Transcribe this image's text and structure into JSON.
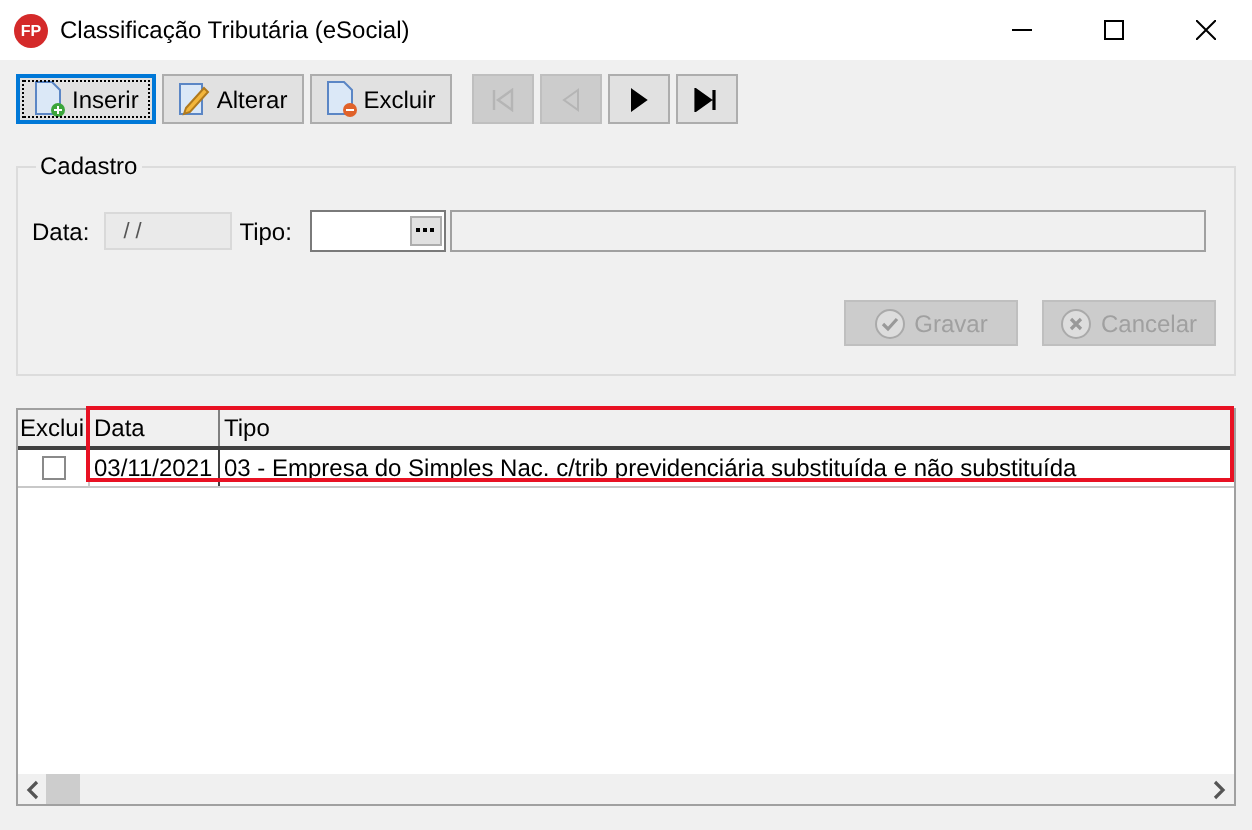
{
  "window": {
    "title": "Classificação Tributária (eSocial)",
    "app_badge": "FP"
  },
  "toolbar": {
    "buttons": [
      {
        "kind": "insert",
        "label": "Inserir",
        "focused": true
      },
      {
        "kind": "edit",
        "label": "Alterar",
        "focused": false
      },
      {
        "kind": "delete",
        "label": "Excluir",
        "focused": false
      }
    ],
    "navigation": [
      {
        "kind": "first",
        "disabled": true
      },
      {
        "kind": "prev",
        "disabled": true
      },
      {
        "kind": "next",
        "disabled": false
      },
      {
        "kind": "last",
        "disabled": false
      }
    ]
  },
  "cadastro": {
    "title": "Cadastro",
    "data_label": "Data:",
    "data_value": "/ /",
    "tipo_label": "Tipo:",
    "buttons": [
      {
        "kind": "save",
        "label": "Gravar",
        "disabled": true
      },
      {
        "kind": "cancel",
        "label": "Cancelar",
        "disabled": true
      }
    ]
  },
  "table": {
    "columns": [
      "Exclui",
      "Data",
      "Tipo"
    ],
    "rows": [
      {
        "checked": false,
        "data": "03/11/2021",
        "tipo": "03 - Empresa do Simples Nac. c/trib previdenciária substituída e não substituída"
      }
    ]
  }
}
